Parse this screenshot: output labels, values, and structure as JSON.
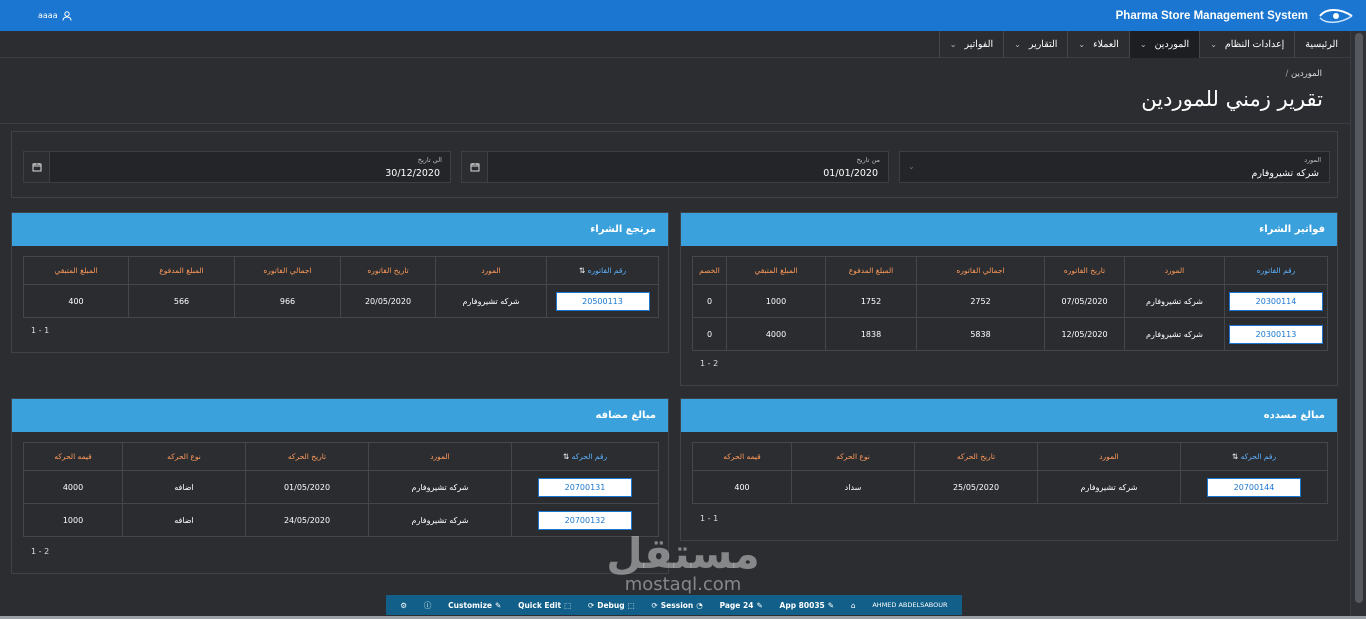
{
  "app": {
    "title": "Pharma Store Management System",
    "user": "aaaa"
  },
  "menu": [
    {
      "label": "الرئيسية",
      "chevron": false,
      "active": false
    },
    {
      "label": "إعدادات النظام",
      "chevron": true,
      "active": false
    },
    {
      "label": "الموردين",
      "chevron": true,
      "active": true
    },
    {
      "label": "العملاء",
      "chevron": true,
      "active": false
    },
    {
      "label": "التقارير",
      "chevron": true,
      "active": false
    },
    {
      "label": "الفواتير",
      "chevron": true,
      "active": false
    }
  ],
  "breadcrumb": {
    "parent": "الموردين",
    "sep": "/"
  },
  "page_title": "تقرير زمني للموردين",
  "filters": {
    "supplier": {
      "label": "المورد",
      "value": "شركه تشيروفارم"
    },
    "from": {
      "label": "من تاريخ",
      "value": "01/01/2020"
    },
    "to": {
      "label": "الي تاريخ",
      "value": "30/12/2020"
    }
  },
  "purchase_invoices": {
    "title": "فواتير الشراء",
    "headers": [
      "رقم الفاتوره",
      "المورد",
      "تاريخ الفاتوره",
      "اجمالي الفاتوره",
      "المبلغ المدفوع",
      "المبلغ المتبقي",
      "الخصم"
    ],
    "rows": [
      [
        "20300114",
        "شركه تشيروفارم",
        "07/05/2020",
        "2752",
        "1752",
        "1000",
        "0"
      ],
      [
        "20300113",
        "شركه تشيروفارم",
        "12/05/2020",
        "5838",
        "1838",
        "4000",
        "0"
      ]
    ],
    "pager": "1 - 2"
  },
  "purchase_returns": {
    "title": "مرتجع الشراء",
    "headers": [
      "رقم الفاتوره",
      "المورد",
      "تاريخ الفاتوره",
      "اجمالي الفاتوره",
      "المبلغ المدفوع",
      "المبلغ المتبقي"
    ],
    "rows": [
      [
        "20500113",
        "شركه تشيروفارم",
        "20/05/2020",
        "966",
        "566",
        "400"
      ]
    ],
    "pager": "1 - 1"
  },
  "paid_amounts": {
    "title": "مبالغ مسدده",
    "headers": [
      "رقم الحركه",
      "المورد",
      "تاريخ الحركه",
      "نوع الحركه",
      "قيمه الحركه"
    ],
    "rows": [
      [
        "20700144",
        "شركه تشيروفارم",
        "25/05/2020",
        "سداد",
        "400"
      ]
    ],
    "pager": "1 - 1"
  },
  "added_amounts": {
    "title": "مبالغ مضافه",
    "headers": [
      "رقم الحركه",
      "المورد",
      "تاريخ الحركه",
      "نوع الحركه",
      "قيمه الحركه"
    ],
    "rows": [
      [
        "20700131",
        "شركه تشيروفارم",
        "01/05/2020",
        "اضافه",
        "4000"
      ],
      [
        "20700132",
        "شركه تشيروفارم",
        "24/05/2020",
        "اضافه",
        "1000"
      ]
    ],
    "pager": "1 - 2"
  },
  "devbar": {
    "customize": "Customize",
    "quick_edit": "Quick Edit",
    "debug": "Debug",
    "session": "Session",
    "page": "Page 24",
    "app": "App 80035",
    "user": "AHMED ABDELSABOUR"
  },
  "watermark": {
    "ar": "مستقل",
    "en": "mostaql.com"
  },
  "colors": {
    "topbar": "#1a76d0",
    "panel_header": "#3aa1dc",
    "header_text": "#ff9a5a",
    "link": "#1a76d0",
    "devbar": "#12608a"
  }
}
